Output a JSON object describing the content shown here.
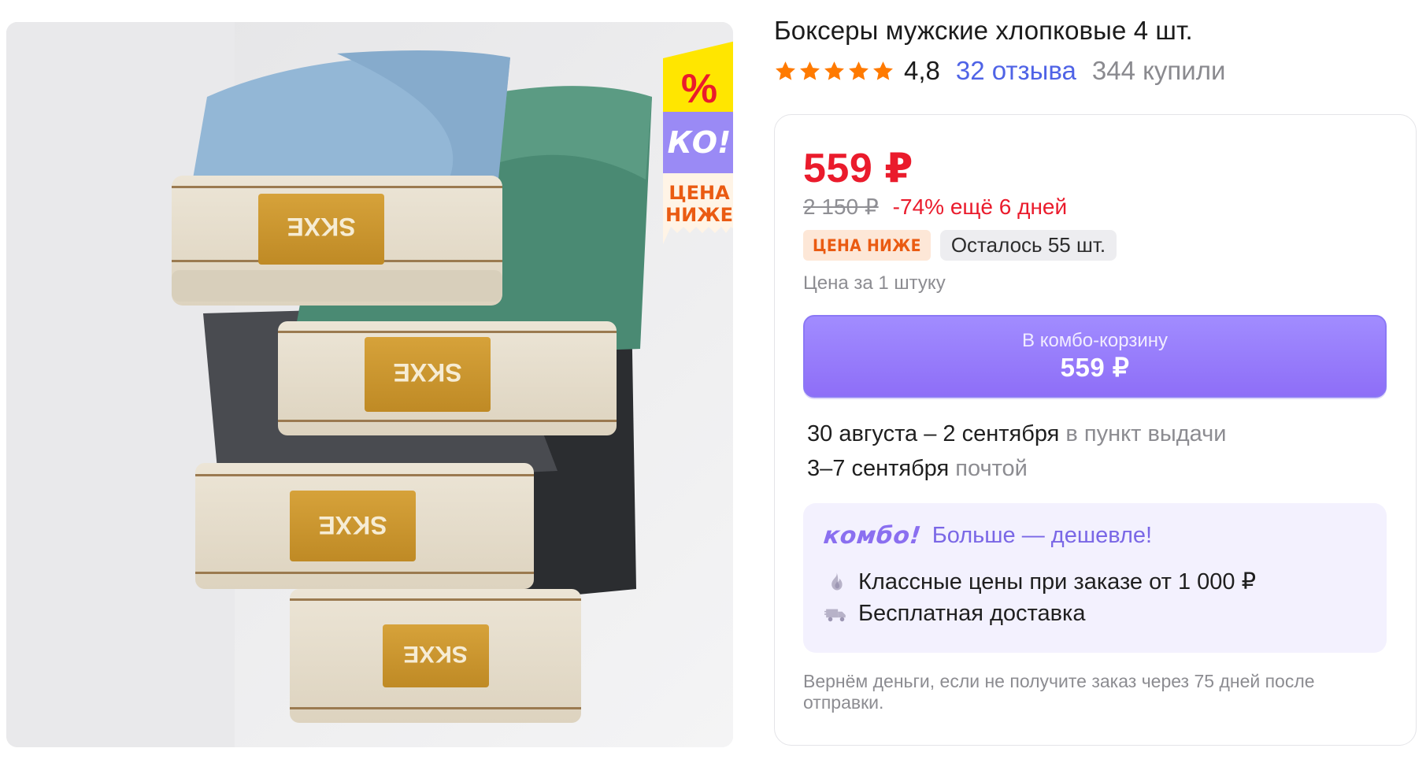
{
  "product": {
    "title": "Боксеры мужские хлопковые 4 шт.",
    "rating": "4,8",
    "stars_filled": 5,
    "reviews_link": "32 отзыва",
    "bought": "344 купили",
    "image_labels": [
      "SKXE",
      "SKXE",
      "SKXE",
      "SKXE"
    ]
  },
  "promo_sticker": {
    "percent": "%",
    "combo": "КО!",
    "line1": "ЦЕНА",
    "line2": "НИЖЕ"
  },
  "price": {
    "current": "559 ₽",
    "old": "2 150 ₽",
    "discount": "-74% ещё 6 дней",
    "badge_lower": "ЦЕНА НИЖЕ",
    "stock": "Осталось 55 шт.",
    "unit_note": "Цена за 1 штуку"
  },
  "cta": {
    "label": "В комбо-корзину",
    "price": "559 ₽"
  },
  "delivery": [
    {
      "date": "30 августа – 2 сентября",
      "method": "в пункт выдачи"
    },
    {
      "date": "3–7 сентября",
      "method": "почтой"
    }
  ],
  "combo": {
    "logo": "комбо!",
    "tagline": "Больше — дешевле!",
    "features": [
      {
        "icon": "fire-icon",
        "text": "Классные цены при заказе от 1 000 ₽"
      },
      {
        "icon": "delivery-truck-icon",
        "text": "Бесплатная доставка"
      }
    ]
  },
  "guarantee": "Вернём деньги, если не получите заказ через 75 дней после отправки.",
  "colors": {
    "price_red": "#ea1b2c",
    "link_blue": "#4f63e6",
    "star_orange": "#ff7a00",
    "combo_purple": "#8e6ef7",
    "combo_bg": "#f3f1fe",
    "badge_orange": "#ea5b12",
    "sticker_yellow": "#ffe600"
  }
}
